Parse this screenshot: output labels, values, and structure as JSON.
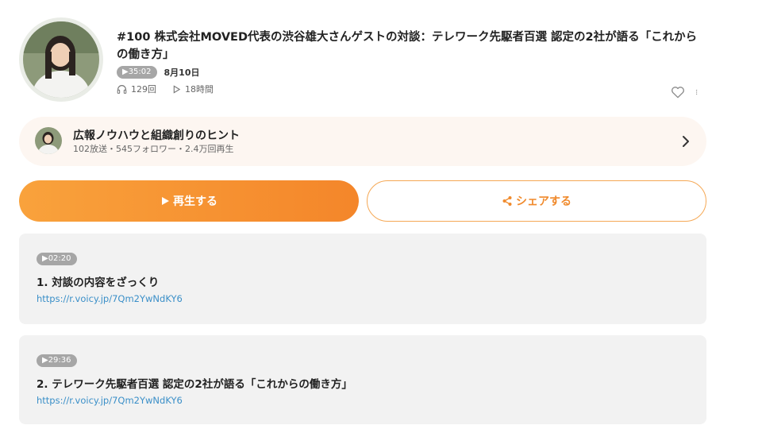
{
  "episode": {
    "title": "#100 株式会社MOVED代表の渋谷雄大さんゲストの対談：テレワーク先駆者百選 認定の2社が語る「これからの働き方」",
    "duration": "▶35:02",
    "date": "8月10日",
    "listens": "129回",
    "plays": "18時間"
  },
  "channel": {
    "name": "広報ノウハウと組織創りのヒント",
    "stats": "102放送・545フォロワー・2.4万回再生"
  },
  "buttons": {
    "play_label": "再生する",
    "share_label": "シェアする"
  },
  "chapters": [
    {
      "timestamp": "▶02:20",
      "title": "1. 対談の内容をざっくり",
      "link": "https://r.voicy.jp/7Qm2YwNdKY6"
    },
    {
      "timestamp": "▶29:36",
      "title": "2. テレワーク先駆者百選 認定の2社が語る「これからの働き方」",
      "link": "https://r.voicy.jp/7Qm2YwNdKY6"
    }
  ],
  "colors": {
    "accent": "#f4862a",
    "link": "#3a8fc8",
    "pill": "#a6a6a6"
  },
  "icons": [
    "headphones-icon",
    "play-count-icon",
    "heart-icon",
    "more-icon",
    "chevron-right-icon",
    "play-icon",
    "share-icon"
  ]
}
